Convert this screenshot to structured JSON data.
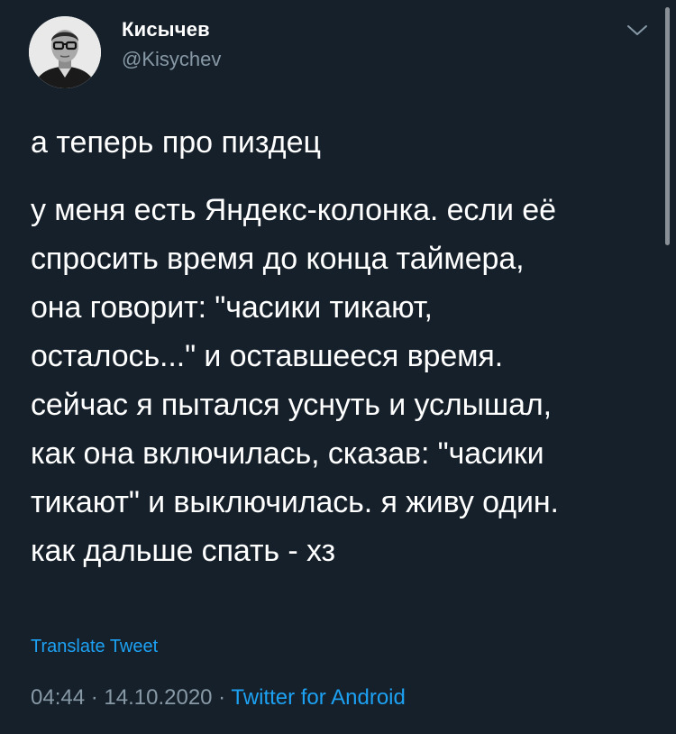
{
  "author": {
    "display_name": "Кисычев",
    "handle": "@Kisychev"
  },
  "icons": {
    "avatar": "avatar-photo",
    "menu": "chevron-down-icon"
  },
  "tweet": {
    "lead": "а теперь про пиздец",
    "lines": [
      "у меня есть Яндекс-колонка. если её",
      "спросить время до конца таймера,",
      "она говорит: \"часики тикают,",
      "осталось...\" и оставшееся время.",
      "сейчас я пытался уснуть и услышал,",
      "как она включилась, сказав: \"часики",
      "тикают\" и выключилась. я живу один.",
      "как дальше спать - хз"
    ]
  },
  "actions": {
    "translate": "Translate Tweet"
  },
  "meta": {
    "time": "04:44",
    "sep1": " · ",
    "date": "14.10.2020",
    "sep2": " · ",
    "source": "Twitter for Android"
  },
  "colors": {
    "background": "#15202b",
    "secondary_text": "#8899a6",
    "accent": "#1da1f2"
  }
}
